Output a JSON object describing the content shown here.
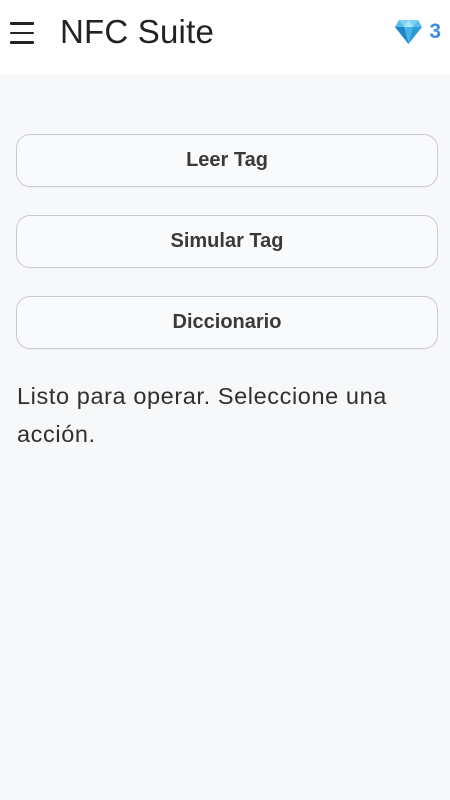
{
  "app": {
    "title": "NFC Suite"
  },
  "header": {
    "menu_icon": "hamburger-menu-icon",
    "gem_icon": "diamond-gem-icon",
    "gem_count": "3",
    "accent_color": "#3d8ede"
  },
  "actions": {
    "read_tag": "Leer Tag",
    "simulate_tag": "Simular Tag",
    "dictionary": "Diccionario"
  },
  "status": {
    "message": "Listo para operar. Seleccione una acción."
  }
}
